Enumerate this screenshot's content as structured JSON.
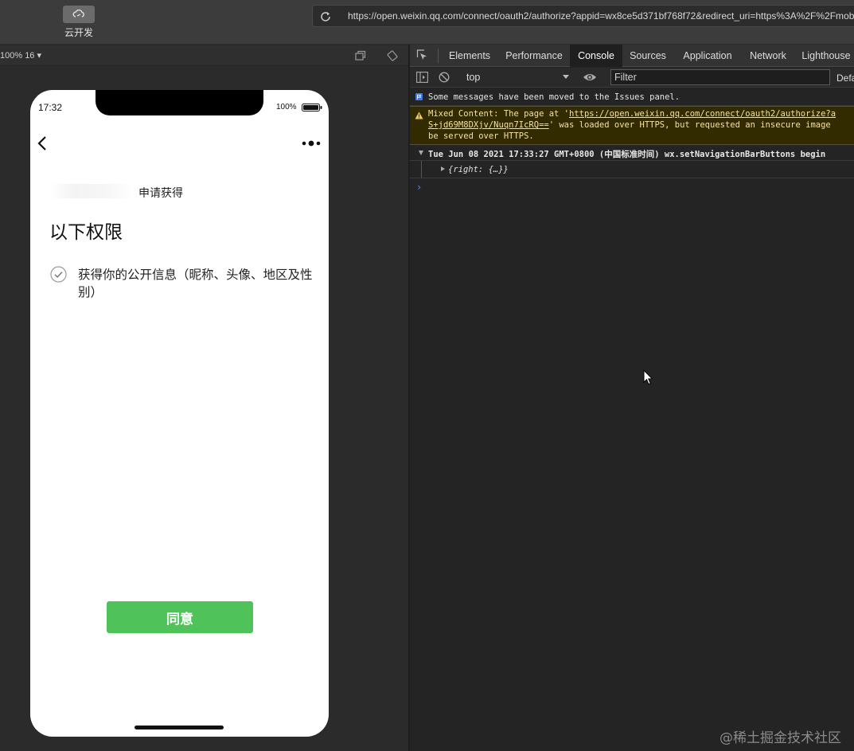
{
  "toolbar": {
    "cloud_label": "云开发",
    "url": "https://open.weixin.qq.com/connect/oauth2/authorize?appid=wx8ce5d371bf768f72&redirect_uri=https%3A%2F%2Fmob"
  },
  "simulator": {
    "zoom_label": "100% 16 ▾"
  },
  "phone": {
    "status_time": "17:32",
    "battery_text": "100%",
    "request_label": "申请获得",
    "permission_title": "以下权限",
    "permission_item": "获得你的公开信息（昵称、头像、地区及性别）",
    "agree_label": "同意"
  },
  "devtools": {
    "tabs": [
      "Elements",
      "Performance",
      "Console",
      "Sources",
      "Application",
      "Network",
      "Lighthouse"
    ],
    "active_tab": "Console",
    "context": "top",
    "filter_placeholder": "Filter",
    "levels_label": "Defa",
    "messages": {
      "info": "Some messages have been moved to the Issues panel.",
      "warn_line1_prefix": "Mixed Content: The page at '",
      "warn_link1": "https://open.weixin.qq.com/connect/oauth2/authorize?a",
      "warn_link2": "S+jd69M8DXjv/Nuqn7IcRQ==",
      "warn_line2_suffix": "' was loaded over HTTPS, but requested an insecure image",
      "warn_line3": "be served over HTTPS.",
      "log": "Tue Jun 08 2021 17:33:27 GMT+0800 (中国标准时间) wx.setNavigationBarButtons begin",
      "object": "{right: {…}}"
    },
    "prompt": "›"
  },
  "watermark": "@稀土掘金技术社区",
  "colors": {
    "agree_button": "#4fc35a",
    "console_active_tab": "#1f1f1f",
    "warning_background": "#332b00"
  }
}
